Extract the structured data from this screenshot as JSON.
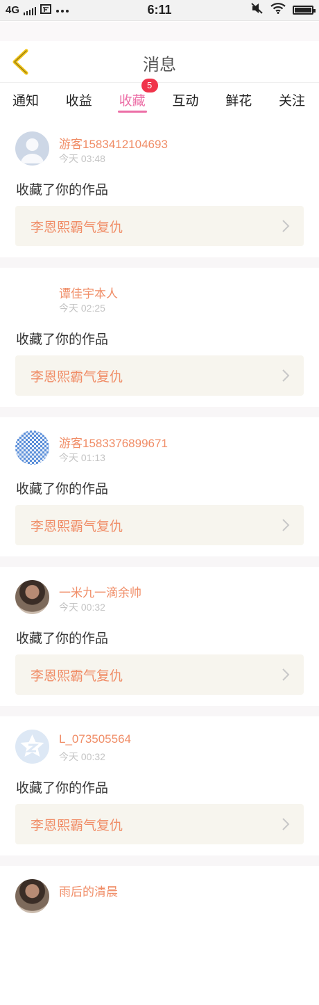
{
  "status_bar": {
    "network": "4G",
    "time": "6:11",
    "icons": [
      "signal-icon",
      "notification-icon",
      "more-icon",
      "mute-icon",
      "wifi-icon",
      "battery-icon"
    ]
  },
  "header": {
    "title": "消息",
    "back_icon": "chevron-left-icon"
  },
  "tabs": [
    {
      "label": "通知"
    },
    {
      "label": "收益"
    },
    {
      "label": "收藏",
      "active": true,
      "badge": "5"
    },
    {
      "label": "互动"
    },
    {
      "label": "鲜花"
    },
    {
      "label": "关注"
    }
  ],
  "colors": {
    "accent": "#ec6ea6",
    "name": "#f08d67",
    "badge": "#f0344b",
    "work_bg": "#f7f5ee"
  },
  "notifications": [
    {
      "user": "游客1583412104693",
      "time": "今天 03:48",
      "action": "收藏了你的作品",
      "work_title": "李恩熙霸气复仇"
    },
    {
      "user": "谭佳宇本人",
      "time": "今天 02:25",
      "action": "收藏了你的作品",
      "work_title": "李恩熙霸气复仇"
    },
    {
      "user": "游客1583376899671",
      "time": "今天 01:13",
      "action": "收藏了你的作品",
      "work_title": "李恩熙霸气复仇"
    },
    {
      "user": "一米九一滴余帅",
      "time": "今天 00:32",
      "action": "收藏了你的作品",
      "work_title": "李恩熙霸气复仇"
    },
    {
      "user": "L_073505564",
      "time": "今天 00:32",
      "action": "收藏了你的作品",
      "work_title": "李恩熙霸气复仇"
    },
    {
      "user": "雨后的清晨"
    }
  ]
}
